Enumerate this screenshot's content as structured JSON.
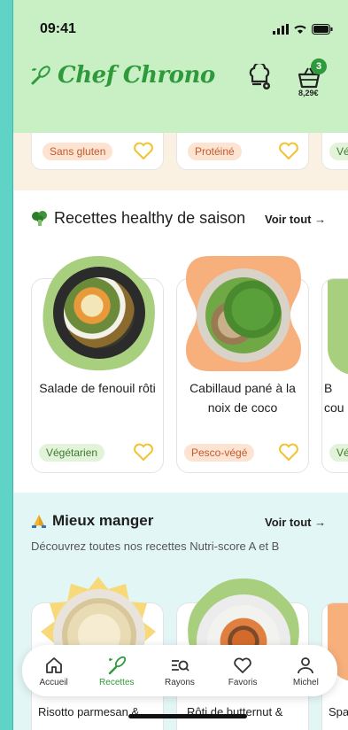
{
  "status": {
    "time": "09:41"
  },
  "brand": {
    "name": "Chef Chrono"
  },
  "cart": {
    "count": "3",
    "amount": "8,29€"
  },
  "top_strip": {
    "cards": [
      {
        "tag": "Sans gluten"
      },
      {
        "tag": "Protéiné"
      },
      {
        "tag": "Vé"
      }
    ]
  },
  "section1": {
    "title": "Recettes healthy de saison",
    "see_all": "Voir tout →",
    "cards": [
      {
        "title": "Salade de fenouil rôti",
        "tag": "Végétarien"
      },
      {
        "title": "Cabillaud pané à la noix de coco",
        "tag": "Pesco-végé"
      },
      {
        "title": "B cou",
        "tag": "Vé"
      }
    ]
  },
  "section2": {
    "title": "Mieux manger",
    "see_all": "Voir tout →",
    "subtitle": "Découvrez toutes nos recettes Nutri-score A et B",
    "cards": [
      {
        "title": "Risotto parmesan &"
      },
      {
        "title": "Rôti de butternut &"
      },
      {
        "title": "Spa"
      }
    ]
  },
  "nav": [
    {
      "label": "Accueil",
      "icon": "home-icon"
    },
    {
      "label": "Recettes",
      "icon": "whisk-icon",
      "active": true
    },
    {
      "label": "Rayons",
      "icon": "aisles-search-icon"
    },
    {
      "label": "Favoris",
      "icon": "heart-icon"
    },
    {
      "label": "Michel",
      "icon": "person-icon"
    }
  ],
  "colors": {
    "brand": "#2f9a3c",
    "header_bg": "#c9f0c4",
    "tag_orange": "#c45a2a",
    "tag_green": "#3a7b2b",
    "heart": "#f2c230"
  }
}
